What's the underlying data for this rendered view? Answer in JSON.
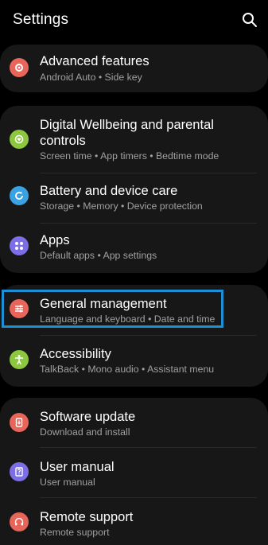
{
  "header": {
    "title": "Settings",
    "search_icon": "search-icon"
  },
  "groups": [
    {
      "items": [
        {
          "label": "Advanced features",
          "sub": "Android Auto  •  Side key",
          "icon": "gear-plus-icon",
          "color": "#e8655a"
        }
      ]
    },
    {
      "items": [
        {
          "label": "Digital Wellbeing and parental controls",
          "sub": "Screen time  •  App timers  •  Bedtime mode",
          "icon": "heart-icon",
          "color": "#8dc63f"
        },
        {
          "label": "Battery and device care",
          "sub": "Storage  •  Memory  •  Device protection",
          "icon": "refresh-icon",
          "color": "#3aa1e3"
        },
        {
          "label": "Apps",
          "sub": "Default apps  •  App settings",
          "icon": "apps-grid-icon",
          "color": "#7b6ee6"
        }
      ]
    },
    {
      "items": [
        {
          "label": "General management",
          "sub": "Language and keyboard  •  Date and time",
          "icon": "sliders-icon",
          "color": "#e8655a"
        },
        {
          "label": "Accessibility",
          "sub": "TalkBack  •  Mono audio  •  Assistant menu",
          "icon": "accessibility-icon",
          "color": "#8dc63f"
        }
      ]
    },
    {
      "items": [
        {
          "label": "Software update",
          "sub": "Download and install",
          "icon": "software-update-icon",
          "color": "#e8655a"
        },
        {
          "label": "User manual",
          "sub": "User manual",
          "icon": "manual-icon",
          "color": "#7b6ee6"
        },
        {
          "label": "Remote support",
          "sub": "Remote support",
          "icon": "headset-icon",
          "color": "#e8655a"
        }
      ]
    }
  ],
  "colors": {
    "background": "#000000",
    "card": "#171717",
    "highlight": "#1c8fd6",
    "subtext": "#a0a0a0"
  }
}
